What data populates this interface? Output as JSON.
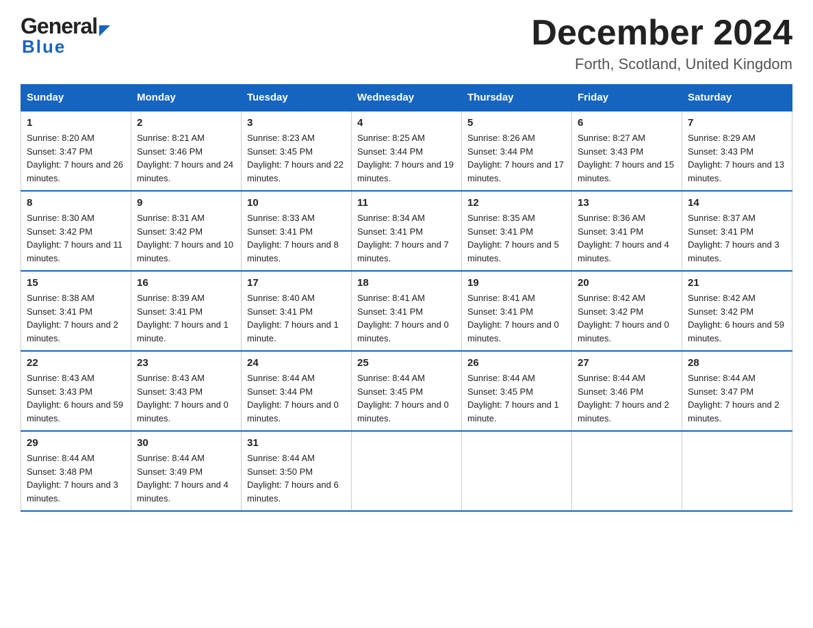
{
  "header": {
    "logo_general": "General",
    "logo_blue": "Blue",
    "month": "December 2024",
    "location": "Forth, Scotland, United Kingdom"
  },
  "days_of_week": [
    "Sunday",
    "Monday",
    "Tuesday",
    "Wednesday",
    "Thursday",
    "Friday",
    "Saturday"
  ],
  "weeks": [
    [
      {
        "day": "1",
        "sunrise": "Sunrise: 8:20 AM",
        "sunset": "Sunset: 3:47 PM",
        "daylight": "Daylight: 7 hours and 26 minutes."
      },
      {
        "day": "2",
        "sunrise": "Sunrise: 8:21 AM",
        "sunset": "Sunset: 3:46 PM",
        "daylight": "Daylight: 7 hours and 24 minutes."
      },
      {
        "day": "3",
        "sunrise": "Sunrise: 8:23 AM",
        "sunset": "Sunset: 3:45 PM",
        "daylight": "Daylight: 7 hours and 22 minutes."
      },
      {
        "day": "4",
        "sunrise": "Sunrise: 8:25 AM",
        "sunset": "Sunset: 3:44 PM",
        "daylight": "Daylight: 7 hours and 19 minutes."
      },
      {
        "day": "5",
        "sunrise": "Sunrise: 8:26 AM",
        "sunset": "Sunset: 3:44 PM",
        "daylight": "Daylight: 7 hours and 17 minutes."
      },
      {
        "day": "6",
        "sunrise": "Sunrise: 8:27 AM",
        "sunset": "Sunset: 3:43 PM",
        "daylight": "Daylight: 7 hours and 15 minutes."
      },
      {
        "day": "7",
        "sunrise": "Sunrise: 8:29 AM",
        "sunset": "Sunset: 3:43 PM",
        "daylight": "Daylight: 7 hours and 13 minutes."
      }
    ],
    [
      {
        "day": "8",
        "sunrise": "Sunrise: 8:30 AM",
        "sunset": "Sunset: 3:42 PM",
        "daylight": "Daylight: 7 hours and 11 minutes."
      },
      {
        "day": "9",
        "sunrise": "Sunrise: 8:31 AM",
        "sunset": "Sunset: 3:42 PM",
        "daylight": "Daylight: 7 hours and 10 minutes."
      },
      {
        "day": "10",
        "sunrise": "Sunrise: 8:33 AM",
        "sunset": "Sunset: 3:41 PM",
        "daylight": "Daylight: 7 hours and 8 minutes."
      },
      {
        "day": "11",
        "sunrise": "Sunrise: 8:34 AM",
        "sunset": "Sunset: 3:41 PM",
        "daylight": "Daylight: 7 hours and 7 minutes."
      },
      {
        "day": "12",
        "sunrise": "Sunrise: 8:35 AM",
        "sunset": "Sunset: 3:41 PM",
        "daylight": "Daylight: 7 hours and 5 minutes."
      },
      {
        "day": "13",
        "sunrise": "Sunrise: 8:36 AM",
        "sunset": "Sunset: 3:41 PM",
        "daylight": "Daylight: 7 hours and 4 minutes."
      },
      {
        "day": "14",
        "sunrise": "Sunrise: 8:37 AM",
        "sunset": "Sunset: 3:41 PM",
        "daylight": "Daylight: 7 hours and 3 minutes."
      }
    ],
    [
      {
        "day": "15",
        "sunrise": "Sunrise: 8:38 AM",
        "sunset": "Sunset: 3:41 PM",
        "daylight": "Daylight: 7 hours and 2 minutes."
      },
      {
        "day": "16",
        "sunrise": "Sunrise: 8:39 AM",
        "sunset": "Sunset: 3:41 PM",
        "daylight": "Daylight: 7 hours and 1 minute."
      },
      {
        "day": "17",
        "sunrise": "Sunrise: 8:40 AM",
        "sunset": "Sunset: 3:41 PM",
        "daylight": "Daylight: 7 hours and 1 minute."
      },
      {
        "day": "18",
        "sunrise": "Sunrise: 8:41 AM",
        "sunset": "Sunset: 3:41 PM",
        "daylight": "Daylight: 7 hours and 0 minutes."
      },
      {
        "day": "19",
        "sunrise": "Sunrise: 8:41 AM",
        "sunset": "Sunset: 3:41 PM",
        "daylight": "Daylight: 7 hours and 0 minutes."
      },
      {
        "day": "20",
        "sunrise": "Sunrise: 8:42 AM",
        "sunset": "Sunset: 3:42 PM",
        "daylight": "Daylight: 7 hours and 0 minutes."
      },
      {
        "day": "21",
        "sunrise": "Sunrise: 8:42 AM",
        "sunset": "Sunset: 3:42 PM",
        "daylight": "Daylight: 6 hours and 59 minutes."
      }
    ],
    [
      {
        "day": "22",
        "sunrise": "Sunrise: 8:43 AM",
        "sunset": "Sunset: 3:43 PM",
        "daylight": "Daylight: 6 hours and 59 minutes."
      },
      {
        "day": "23",
        "sunrise": "Sunrise: 8:43 AM",
        "sunset": "Sunset: 3:43 PM",
        "daylight": "Daylight: 7 hours and 0 minutes."
      },
      {
        "day": "24",
        "sunrise": "Sunrise: 8:44 AM",
        "sunset": "Sunset: 3:44 PM",
        "daylight": "Daylight: 7 hours and 0 minutes."
      },
      {
        "day": "25",
        "sunrise": "Sunrise: 8:44 AM",
        "sunset": "Sunset: 3:45 PM",
        "daylight": "Daylight: 7 hours and 0 minutes."
      },
      {
        "day": "26",
        "sunrise": "Sunrise: 8:44 AM",
        "sunset": "Sunset: 3:45 PM",
        "daylight": "Daylight: 7 hours and 1 minute."
      },
      {
        "day": "27",
        "sunrise": "Sunrise: 8:44 AM",
        "sunset": "Sunset: 3:46 PM",
        "daylight": "Daylight: 7 hours and 2 minutes."
      },
      {
        "day": "28",
        "sunrise": "Sunrise: 8:44 AM",
        "sunset": "Sunset: 3:47 PM",
        "daylight": "Daylight: 7 hours and 2 minutes."
      }
    ],
    [
      {
        "day": "29",
        "sunrise": "Sunrise: 8:44 AM",
        "sunset": "Sunset: 3:48 PM",
        "daylight": "Daylight: 7 hours and 3 minutes."
      },
      {
        "day": "30",
        "sunrise": "Sunrise: 8:44 AM",
        "sunset": "Sunset: 3:49 PM",
        "daylight": "Daylight: 7 hours and 4 minutes."
      },
      {
        "day": "31",
        "sunrise": "Sunrise: 8:44 AM",
        "sunset": "Sunset: 3:50 PM",
        "daylight": "Daylight: 7 hours and 6 minutes."
      },
      null,
      null,
      null,
      null
    ]
  ]
}
